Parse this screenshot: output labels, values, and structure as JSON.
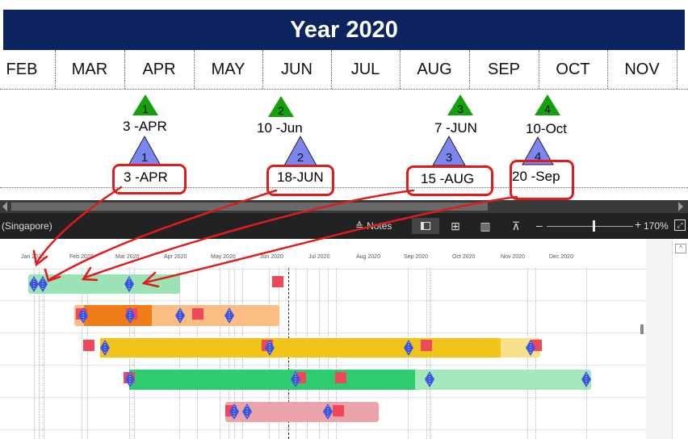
{
  "slide": {
    "title": "Year 2020",
    "months": [
      "FEB",
      "MAR",
      "APR",
      "MAY",
      "JUN",
      "JUL",
      "AUG",
      "SEP",
      "OCT",
      "NOV"
    ],
    "green_markers": [
      {
        "num": "1",
        "date": "3 -APR"
      },
      {
        "num": "2",
        "date": "10 -Jun"
      },
      {
        "num": "3",
        "date": "7 -JUN"
      },
      {
        "num": "4",
        "date": "10-Oct"
      }
    ],
    "blue_markers": [
      {
        "num": "1",
        "date": "3 -APR"
      },
      {
        "num": "2",
        "date": "18-JUN"
      },
      {
        "num": "3",
        "date": "15 -AUG"
      },
      {
        "num": "4",
        "date": "20 -Sep"
      }
    ]
  },
  "statusbar": {
    "region": "(Singapore)",
    "notes_label": "Notes",
    "zoom": "170%"
  },
  "gantt": {
    "ticks": [
      "Jan 2020",
      "Feb 2020",
      "Mar 2020",
      "Apr 2020",
      "May 2020",
      "Jun 2020",
      "Jul 2020",
      "Aug 2020",
      "Sep 2020",
      "Oct 2020",
      "Nov 2020",
      "Dec 2020"
    ]
  },
  "colors": {
    "title_bar": "#0d2460",
    "green": "#13a10e",
    "blue": "#7b86f0",
    "annotation": "#e01b1b",
    "row1": "#9be3b4",
    "row2_dark": "#f07d1a",
    "row2_light": "#fbbd83",
    "row3_dark": "#f0c419",
    "row3_light": "#f8e08a",
    "row4_dark": "#2ecc71",
    "row4_light": "#a3e8bc",
    "row5": "#eba4aa"
  }
}
